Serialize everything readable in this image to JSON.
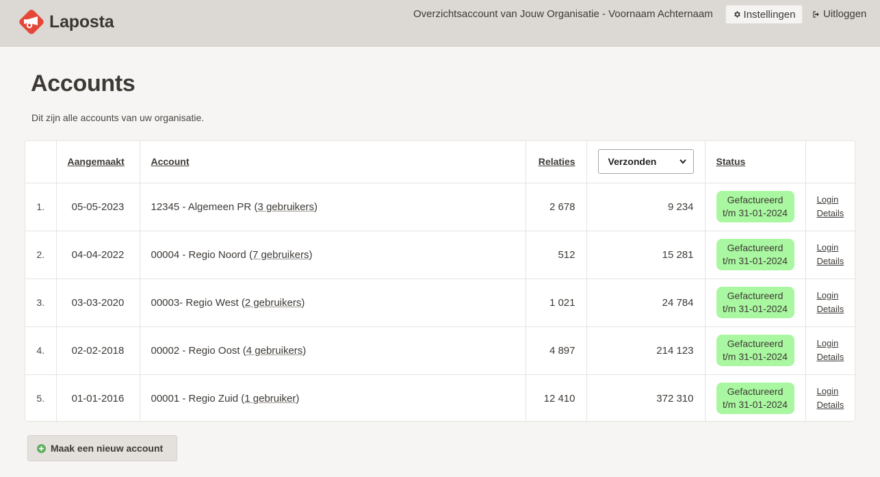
{
  "header": {
    "brand": "Laposta",
    "account_name": "Overzichtsaccount van Jouw Organisatie - Voornaam Achternaam",
    "settings_label": "Instellingen",
    "logout_label": "Uitloggen"
  },
  "page": {
    "title": "Accounts",
    "intro": "Dit zijn alle accounts van uw organisatie."
  },
  "table": {
    "columns": {
      "created": "Aangemaakt",
      "account": "Account",
      "relations": "Relaties",
      "sent_select": "Verzonden",
      "status": "Status"
    },
    "rows": [
      {
        "index": "1.",
        "created": "05-05-2023",
        "account": "12345 - Algemeen PR",
        "users_open": "(",
        "users": "3 gebruikers",
        "users_close": ")",
        "relations": "2 678",
        "sent": "9 234",
        "status_line1": "Gefactureerd",
        "status_line2": "t/m 31-01-2024",
        "login": "Login",
        "details": "Details"
      },
      {
        "index": "2.",
        "created": "04-04-2022",
        "account": "00004 - Regio Noord",
        "users_open": "(",
        "users": "7 gebruikers",
        "users_close": ")",
        "relations": "512",
        "sent": "15 281",
        "status_line1": "Gefactureerd",
        "status_line2": "t/m 31-01-2024",
        "login": "Login",
        "details": "Details"
      },
      {
        "index": "3.",
        "created": "03-03-2020",
        "account": "00003- Regio West",
        "users_open": "(",
        "users": "2 gebruikers",
        "users_close": ")",
        "relations": "1 021",
        "sent": "24 784",
        "status_line1": "Gefactureerd",
        "status_line2": "t/m 31-01-2024",
        "login": "Login",
        "details": "Details"
      },
      {
        "index": "4.",
        "created": "02-02-2018",
        "account": "00002 - Regio Oost",
        "users_open": "(",
        "users": "4 gebruikers",
        "users_close": ")",
        "relations": "4 897",
        "sent": "214 123",
        "status_line1": "Gefactureerd",
        "status_line2": "t/m 31-01-2024",
        "login": "Login",
        "details": "Details"
      },
      {
        "index": "5.",
        "created": "01-01-2016",
        "account": "00001 - Regio Zuid",
        "users_open": "(",
        "users": "1 gebruiker",
        "users_close": ")",
        "relations": "12 410",
        "sent": "372 310",
        "status_line1": "Gefactureerd",
        "status_line2": "t/m 31-01-2024",
        "login": "Login",
        "details": "Details"
      }
    ]
  },
  "actions": {
    "new_account_label": "Maak een nieuw account"
  },
  "colors": {
    "header_bg": "#dcd8d3",
    "page_bg": "#f6f5f3",
    "brand_red": "#e4473a",
    "status_green": "#a9f7a0",
    "plus_green": "#5fae5c"
  },
  "icons": {
    "logo": "laposta-horn-icon",
    "settings": "gear-icon",
    "logout": "sign-out-icon",
    "select": "chevron-down-icon",
    "new": "plus-circle-icon"
  }
}
